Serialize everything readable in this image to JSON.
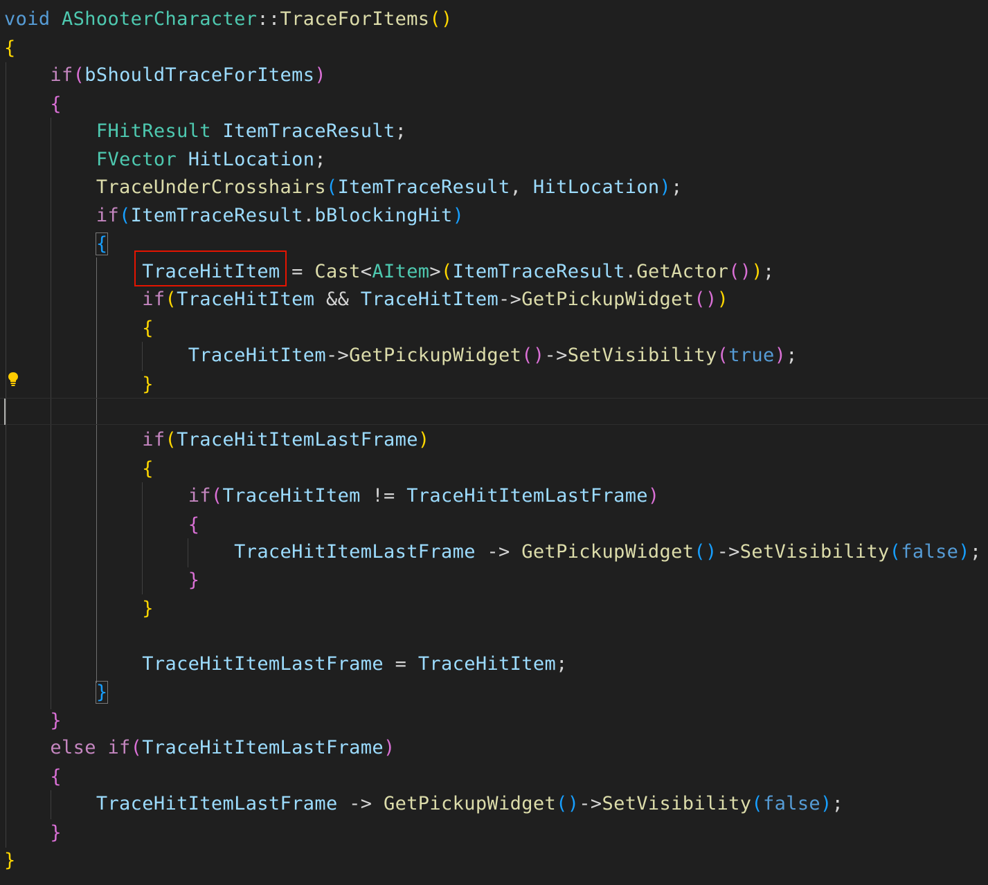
{
  "editor": {
    "language": "C++",
    "theme_colors": {
      "background": "#1f1f1f",
      "keyword": "#569cd6",
      "control": "#c586c0",
      "type": "#4ec9b0",
      "function": "#dcdcaa",
      "variable": "#9cdcfe",
      "bracket_1": "#ffd700",
      "bracket_2": "#da70d6",
      "bracket_3": "#179fff",
      "highlight_box": "#e51400"
    },
    "icons": {
      "lightbulb": "lightbulb-icon"
    },
    "tokens": {
      "void": "void",
      "class_name": "AShooterCharacter",
      "scope": "::",
      "func_name": "TraceForItems",
      "if": "if",
      "else": "else",
      "true": "true",
      "false": "false",
      "b_should_trace": "bShouldTraceForItems",
      "fhitresult": "FHitResult",
      "fvector": "FVector",
      "item_trace_result": "ItemTraceResult",
      "hit_location": "HitLocation",
      "trace_under_crosshairs": "TraceUnderCrosshairs",
      "b_blocking_hit": "bBlockingHit",
      "trace_hit_item": "TraceHitItem",
      "cast": "Cast",
      "aitem": "AItem",
      "get_actor": "GetActor",
      "get_pickup_widget": "GetPickupWidget",
      "set_visibility": "SetVisibility",
      "trace_hit_item_last_frame": "TraceHitItemLastFrame",
      "dot": ".",
      "arrow": "->",
      "arrow_spaced": " -> ",
      "semi": ";",
      "comma_sp": ", ",
      "sp": " ",
      "and": " && ",
      "neq": " != ",
      "assign": " = ",
      "lt": "<",
      "gt": ">",
      "lparen": "(",
      "rparen": ")",
      "lbrace": "{",
      "rbrace": "}",
      "i1": "    ",
      "i2": "        ",
      "i3": "            ",
      "i4": "                "
    }
  }
}
